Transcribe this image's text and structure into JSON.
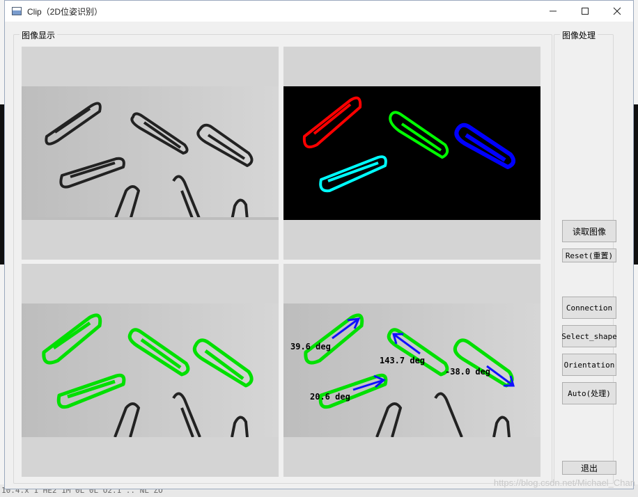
{
  "window": {
    "title": "Clip（2D位姿识别）"
  },
  "groups": {
    "display_title": "图像显示",
    "process_title": "图像处理"
  },
  "buttons": {
    "read_image": "读取图像",
    "reset": "Reset(重置)",
    "connection": "Connection",
    "select_shape": "Select_shape",
    "orientation": "Orientation",
    "auto": "Auto(处理)",
    "exit": "退出"
  },
  "annotations": {
    "angle_1": "39.6 deg",
    "angle_2": "143.7 deg",
    "angle_3": "-38.0 deg",
    "angle_4": "20.6 deg"
  },
  "region_colors": {
    "red": "#ff0000",
    "green": "#00ff00",
    "blue": "#0000ff",
    "cyan": "#00ffff"
  },
  "background": {
    "bottom_text": "10.4.x   1 HE2 1M 0L 0L O2.1 .. NL ZO",
    "watermark": "https://blog.csdn.net/Michael_Chan"
  }
}
